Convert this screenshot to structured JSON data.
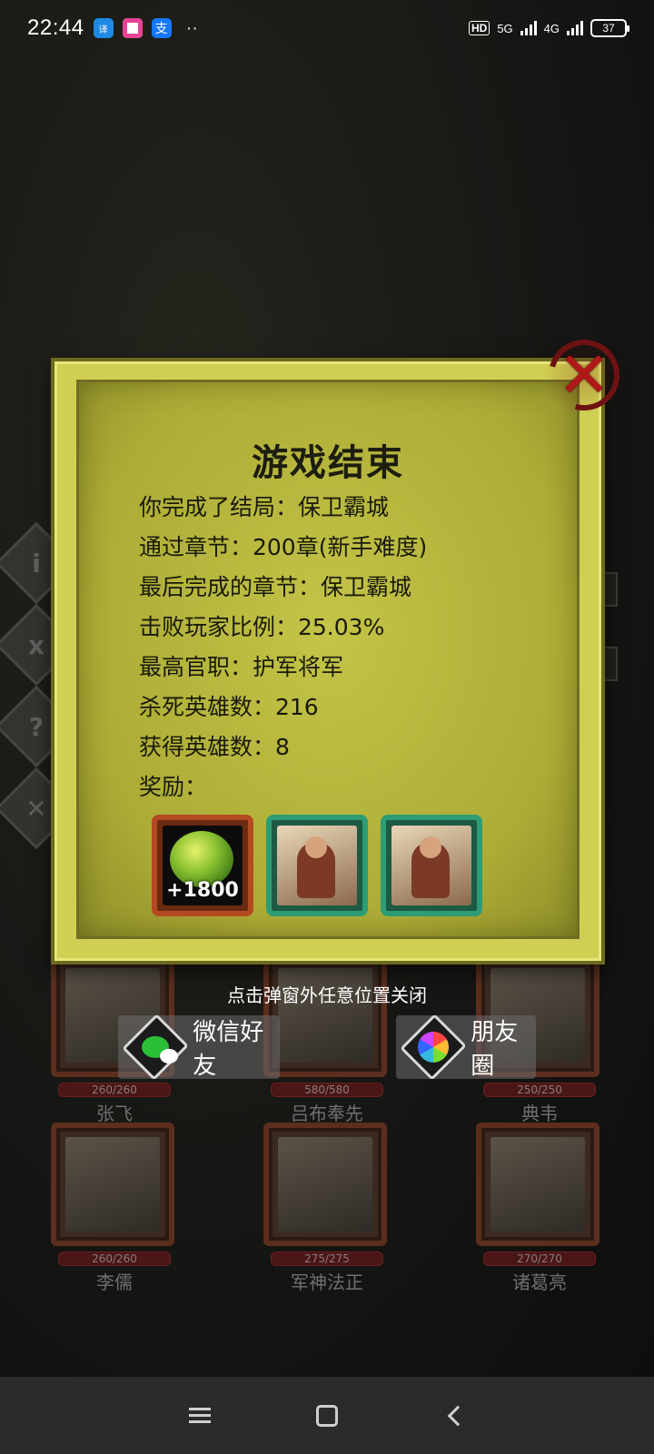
{
  "status_bar": {
    "time": "22:44",
    "app_icons": [
      "translate-app-icon",
      "photo-app-icon",
      "alipay-app-icon"
    ],
    "network_5g": "5G",
    "network_4g": "4G",
    "battery": "37"
  },
  "dialog": {
    "title": "游戏结束",
    "lines": [
      "你完成了结局：保卫霸城",
      "通过章节：200章(新手难度)",
      "最后完成的章节：保卫霸城",
      "击败玩家比例：25.03%",
      "最高官职：护军将军",
      "杀死英雄数：216",
      "获得英雄数：8",
      "奖励："
    ],
    "rewards": [
      {
        "type": "gem",
        "count": "+1800"
      },
      {
        "type": "hero"
      },
      {
        "type": "hero"
      }
    ]
  },
  "hint": "点击弹窗外任意位置关闭",
  "share": {
    "wechat_label": "微信好友",
    "moments_label": "朋友圈"
  },
  "heroes": [
    {
      "name": "张飞",
      "hp": "260/260"
    },
    {
      "name": "吕布奉先",
      "hp": "580/580"
    },
    {
      "name": "典韦",
      "hp": "250/250"
    },
    {
      "name": "李儒",
      "hp": "260/260"
    },
    {
      "name": "军神法正",
      "hp": "275/275"
    },
    {
      "name": "诸葛亮",
      "hp": "270/270"
    }
  ]
}
